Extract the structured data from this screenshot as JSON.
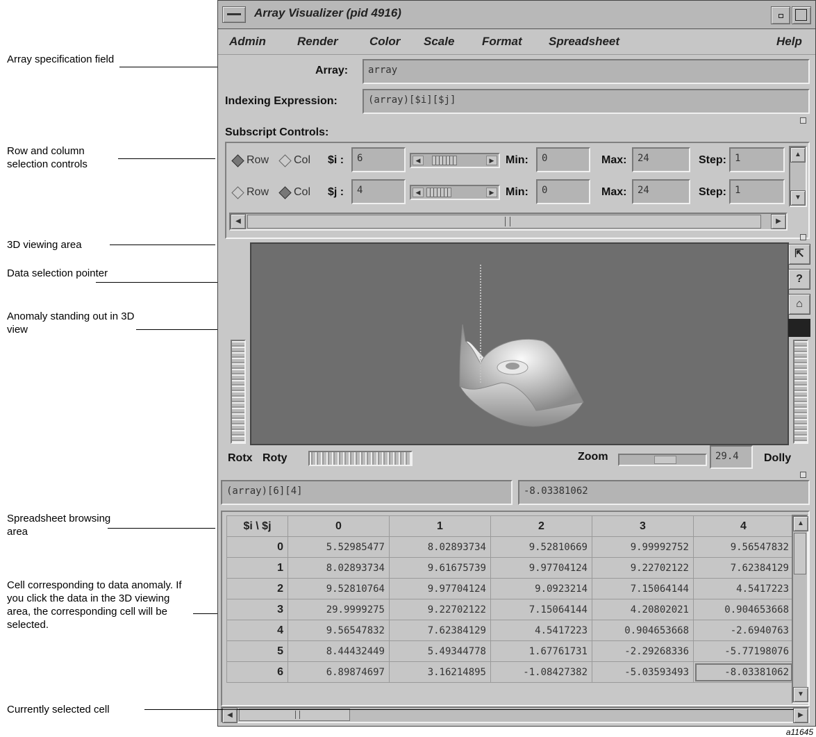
{
  "window": {
    "title": "Array Visualizer (pid 4916)"
  },
  "menubar": [
    "Admin",
    "Render",
    "Color",
    "Scale",
    "Format",
    "Spreadsheet",
    "Help"
  ],
  "array_field": {
    "label": "Array:",
    "value": "array"
  },
  "indexing_field": {
    "label": "Indexing Expression:",
    "value": "(array)[$i][$j]"
  },
  "subscript": {
    "heading": "Subscript Controls:",
    "rows": [
      {
        "row_label": "Row",
        "col_label": "Col",
        "selected": "Row",
        "var": "$i :",
        "value": "6",
        "min_label": "Min:",
        "min": "0",
        "max_label": "Max:",
        "max": "24",
        "step_label": "Step:",
        "step": "1"
      },
      {
        "row_label": "Row",
        "col_label": "Col",
        "selected": "Col",
        "var": "$j :",
        "value": "4",
        "min_label": "Min:",
        "min": "0",
        "max_label": "Max:",
        "max": "24",
        "step_label": "Step:",
        "step": "1"
      }
    ]
  },
  "viewer": {
    "rotx_label": "Rotx",
    "roty_label": "Roty",
    "zoom_label": "Zoom",
    "zoom_value": "29.4",
    "dolly_label": "Dolly",
    "icons": [
      "view-pointer-icon",
      "help-icon",
      "home-icon"
    ]
  },
  "selection": {
    "expression": "(array)[6][4]",
    "value": "-8.03381062"
  },
  "spreadsheet": {
    "corner": "$i \\ $j",
    "columns": [
      "0",
      "1",
      "2",
      "3",
      "4"
    ],
    "rows": [
      {
        "label": "0",
        "cells": [
          "5.52985477",
          "8.02893734",
          "9.52810669",
          "9.99992752",
          "9.56547832"
        ]
      },
      {
        "label": "1",
        "cells": [
          "8.02893734",
          "9.61675739",
          "9.97704124",
          "9.22702122",
          "7.62384129"
        ]
      },
      {
        "label": "2",
        "cells": [
          "9.52810764",
          "9.97704124",
          "9.0923214",
          "7.15064144",
          "4.5417223"
        ]
      },
      {
        "label": "3",
        "cells": [
          "29.9999275",
          "9.22702122",
          "7.15064144",
          "4.20802021",
          "0.904653668"
        ]
      },
      {
        "label": "4",
        "cells": [
          "9.56547832",
          "7.62384129",
          "4.5417223",
          "0.904653668",
          "-2.6940763"
        ]
      },
      {
        "label": "5",
        "cells": [
          "8.44432449",
          "5.49344778",
          "1.67761731",
          "-2.29268336",
          "-5.77198076"
        ]
      },
      {
        "label": "6",
        "cells": [
          "6.89874697",
          "3.16214895",
          "-1.08427382",
          "-5.03593493",
          "-8.03381062"
        ]
      }
    ]
  },
  "callouts": [
    "Array specification field",
    "Row and column selection controls",
    "3D viewing area",
    "Data selection pointer",
    "Anomaly standing out in 3D view",
    "Spreadsheet browsing area",
    "Cell corresponding to data anomaly.  If you click the data in the 3D viewing area, the corresponding cell will be selected.",
    "Currently selected cell"
  ],
  "figure_id": "a11645"
}
